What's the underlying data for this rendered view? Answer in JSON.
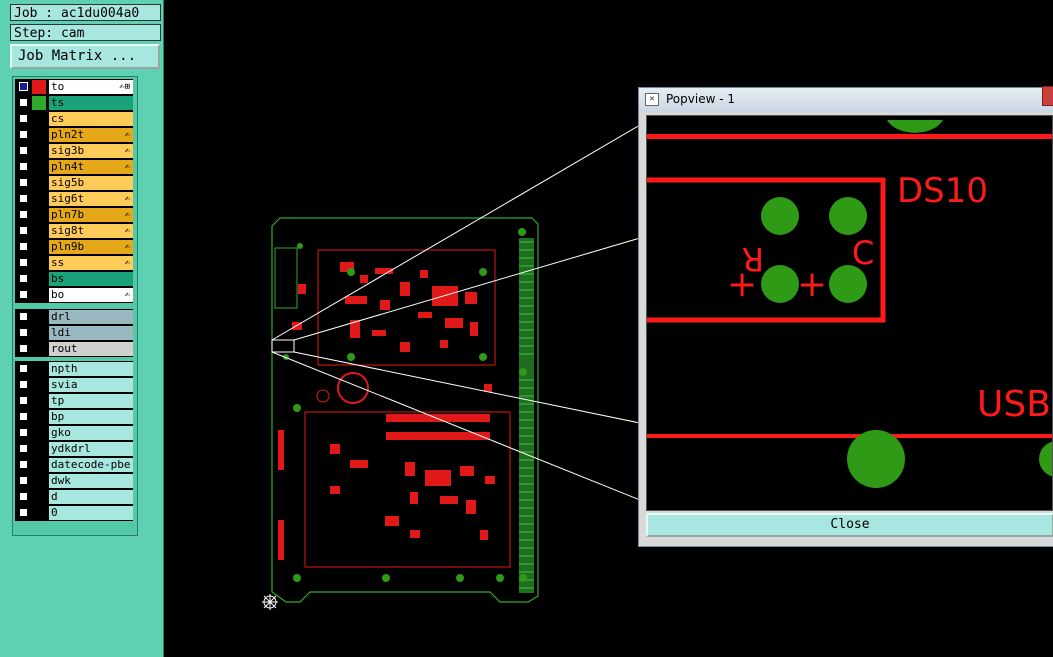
{
  "job": {
    "text": "Job : ac1du004a0"
  },
  "step": {
    "text": "Step: cam"
  },
  "job_matrix": {
    "label": "Job Matrix ..."
  },
  "groups": [
    {
      "layers": [
        {
          "name": "to",
          "bg": "#ffffff",
          "sw": "#e01818",
          "checked": true,
          "flag": "✍⊞"
        },
        {
          "name": "ts",
          "bg": "#1aa37a",
          "sw": "#2ea82e",
          "checked": false,
          "flag": ""
        },
        {
          "name": "cs",
          "bg": "#ffcc5a",
          "sw": "#000000",
          "checked": false,
          "flag": ""
        },
        {
          "name": "pln2t",
          "bg": "#e6a818",
          "sw": "#000000",
          "checked": false,
          "flag": "✍"
        },
        {
          "name": "sig3b",
          "bg": "#ffcc5a",
          "sw": "#000000",
          "checked": false,
          "flag": "✍"
        },
        {
          "name": "pln4t",
          "bg": "#e6a818",
          "sw": "#000000",
          "checked": false,
          "flag": "✍"
        },
        {
          "name": "sig5b",
          "bg": "#ffcc5a",
          "sw": "#000000",
          "checked": false,
          "flag": ""
        },
        {
          "name": "sig6t",
          "bg": "#ffcc5a",
          "sw": "#000000",
          "checked": false,
          "flag": "✍"
        },
        {
          "name": "pln7b",
          "bg": "#e6a818",
          "sw": "#000000",
          "checked": false,
          "flag": "✍"
        },
        {
          "name": "sig8t",
          "bg": "#ffcc5a",
          "sw": "#000000",
          "checked": false,
          "flag": "✍"
        },
        {
          "name": "pln9b",
          "bg": "#e6a818",
          "sw": "#000000",
          "checked": false,
          "flag": "✍"
        },
        {
          "name": "ss",
          "bg": "#ffcc5a",
          "sw": "#000000",
          "checked": false,
          "flag": "✍"
        },
        {
          "name": "bs",
          "bg": "#1aa37a",
          "sw": "#000000",
          "checked": false,
          "flag": ""
        },
        {
          "name": "bo",
          "bg": "#ffffff",
          "sw": "#000000",
          "checked": false,
          "flag": "✍"
        }
      ]
    },
    {
      "layers": [
        {
          "name": "drl",
          "bg": "#9ab8bf",
          "sw": "#000000",
          "checked": false,
          "flag": ""
        },
        {
          "name": "ldi",
          "bg": "#9ab8bf",
          "sw": "#000000",
          "checked": false,
          "flag": ""
        },
        {
          "name": "rout",
          "bg": "#d0d0d0",
          "sw": "#000000",
          "checked": false,
          "flag": ""
        }
      ]
    },
    {
      "layers": [
        {
          "name": "npth",
          "bg": "#a8e6e0",
          "sw": "#000000",
          "checked": false,
          "flag": ""
        },
        {
          "name": "svia",
          "bg": "#a8e6e0",
          "sw": "#000000",
          "checked": false,
          "flag": ""
        },
        {
          "name": "tp",
          "bg": "#a8e6e0",
          "sw": "#000000",
          "checked": false,
          "flag": ""
        },
        {
          "name": "bp",
          "bg": "#a8e6e0",
          "sw": "#000000",
          "checked": false,
          "flag": ""
        },
        {
          "name": "gko",
          "bg": "#a8e6e0",
          "sw": "#000000",
          "checked": false,
          "flag": ""
        },
        {
          "name": "ydkdrl",
          "bg": "#a8e6e0",
          "sw": "#000000",
          "checked": false,
          "flag": ""
        },
        {
          "name": "datecode-pbe",
          "bg": "#a8e6e0",
          "sw": "#000000",
          "checked": false,
          "flag": ""
        },
        {
          "name": "dwk",
          "bg": "#a8e6e0",
          "sw": "#000000",
          "checked": false,
          "flag": ""
        },
        {
          "name": "d",
          "bg": "#a8e6e0",
          "sw": "#000000",
          "checked": false,
          "flag": ""
        },
        {
          "name": "0",
          "bg": "#a8e6e0",
          "sw": "#000000",
          "checked": false,
          "flag": ""
        }
      ]
    }
  ],
  "popview": {
    "title": "Popview - 1",
    "close_label": "Close",
    "labels": {
      "ds10": "DS10",
      "usb": "USB",
      "r": "R",
      "c": "C",
      "plus1": "+",
      "plus2": "+"
    }
  },
  "colors": {
    "copper": "#ff1a1a",
    "pad": "#2e9a16",
    "outline": "#2fa82f"
  }
}
